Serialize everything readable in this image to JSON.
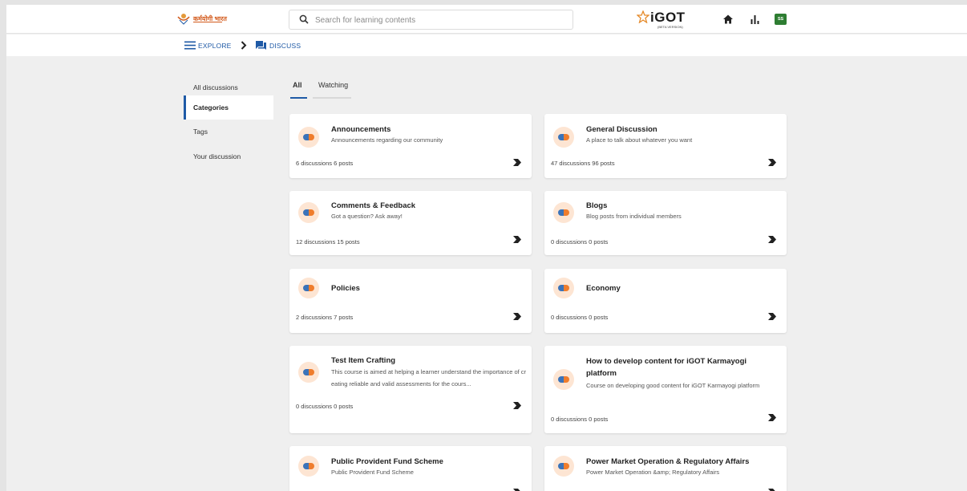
{
  "header": {
    "logo_text": "कर्मयोगी भारत",
    "search_placeholder": "Search for learning contents",
    "brand": "iGOT",
    "brand_sub": "(BETA VERSION)",
    "avatar_initials": "SS"
  },
  "breadcrumb": {
    "explore": "EXPLORE",
    "discuss": "DISCUSS"
  },
  "sidebar": {
    "items": [
      {
        "label": "All discussions"
      },
      {
        "label": "Categories"
      },
      {
        "label": "Tags"
      },
      {
        "label": "Your discussion"
      }
    ]
  },
  "tabs": [
    {
      "label": "All"
    },
    {
      "label": "Watching"
    }
  ],
  "categories": [
    {
      "title": "Announcements",
      "description": "Announcements regarding our community",
      "stats": "6 discussions   6 posts"
    },
    {
      "title": "General Discussion",
      "description": "A place to talk about whatever you want",
      "stats": "47 discussions   96 posts"
    },
    {
      "title": "Comments & Feedback",
      "description": "Got a question? Ask away!",
      "stats": "12 discussions   15 posts"
    },
    {
      "title": "Blogs",
      "description": "Blog posts from individual members",
      "stats": "0 discussions   0 posts"
    },
    {
      "title": "Policies",
      "description": "",
      "stats": "2 discussions   7 posts"
    },
    {
      "title": "Economy",
      "description": "",
      "stats": "0 discussions   0 posts"
    },
    {
      "title": "Test Item Crafting",
      "description": "This course is aimed at helping a learner understand the importance of creating reliable and valid assessments for the cours...",
      "stats": "0 discussions   0 posts"
    },
    {
      "title": "How to develop content for iGOT Karmayogi platform",
      "description": "Course on developing good content for iGOT Karmayogi platform",
      "stats": "0 discussions   0 posts"
    },
    {
      "title": "Public Provident Fund Scheme",
      "description": "Public Provident Fund Scheme",
      "stats": ""
    },
    {
      "title": "Power Market Operation & Regulatory Affairs",
      "description": "Power Market Operation &amp; Regulatory Affairs",
      "stats": ""
    }
  ]
}
